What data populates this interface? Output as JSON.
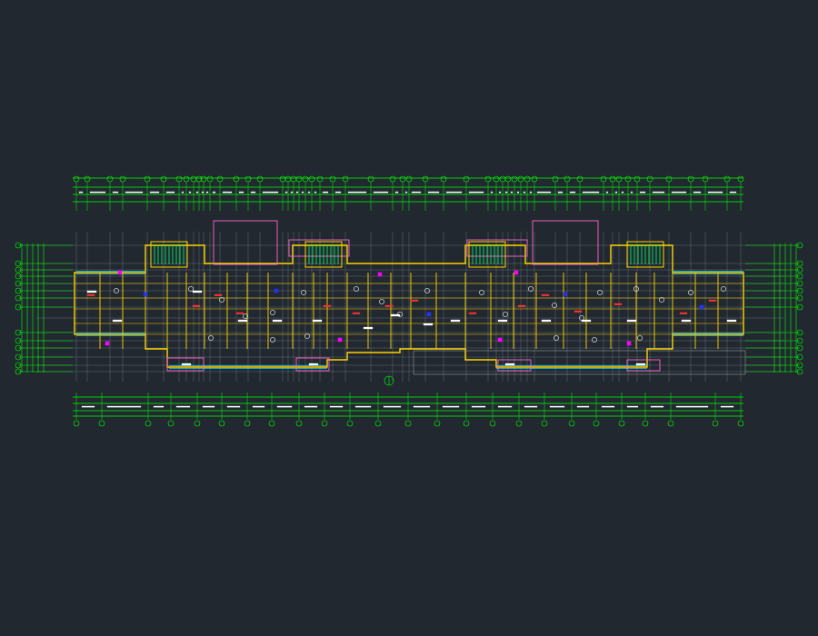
{
  "drawing": {
    "title": "",
    "scale": "",
    "note_line_1": "",
    "note_line_2": "",
    "north_marker_label": ""
  },
  "colors": {
    "background": "#212830",
    "axis_lines": "#00ff00",
    "walls": "#ffd400",
    "balconies": "#ff66cc",
    "stair": "#00ff66",
    "grid_gray": "#a7acb3",
    "red": "#ff3030",
    "cyan": "#22d3ee",
    "blue": "#2233ff",
    "magenta": "#ff00ff",
    "white": "#ffffff"
  },
  "grid_axes": {
    "horizontal_count_top": 48,
    "horizontal_count_bottom": 26,
    "vertical_count_each_side": 12
  }
}
